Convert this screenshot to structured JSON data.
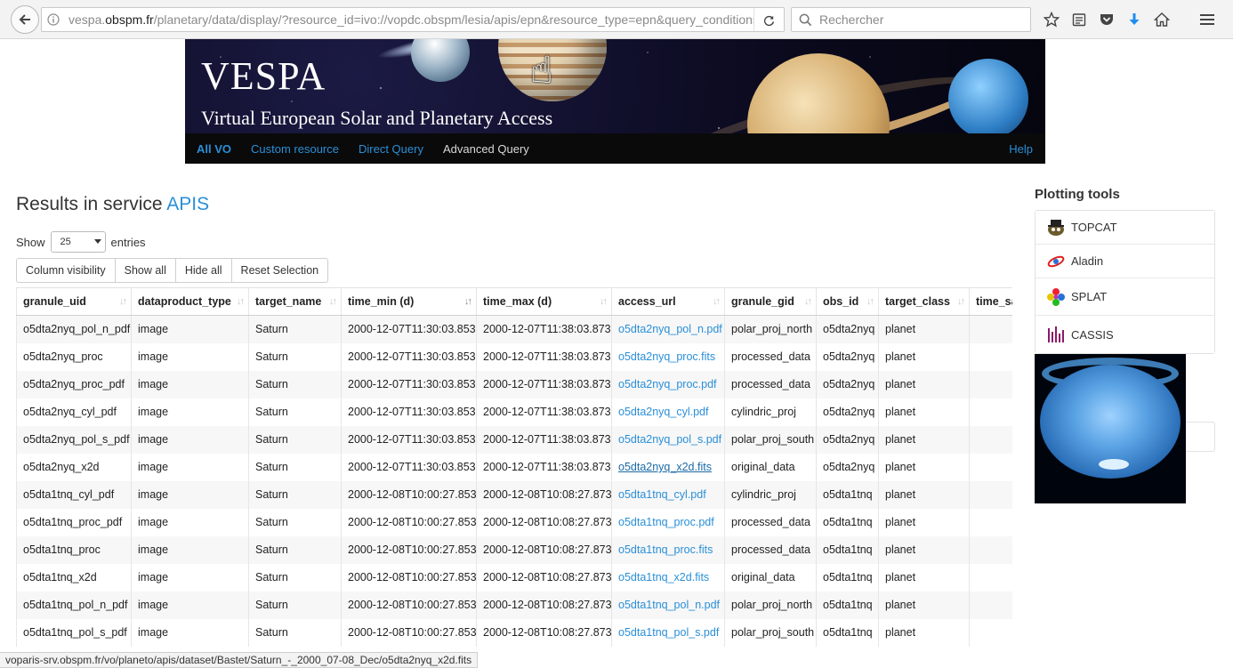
{
  "browser": {
    "url_prefix": "vespa.",
    "url_host": "obspm.fr",
    "url_path": "/planetary/data/display/?resource_id=ivo://vopdc.obspm/lesia/apis/epn&resource_type=epn&query_conditions",
    "search_placeholder": "Rechercher"
  },
  "banner": {
    "logo": "VESPA",
    "subtitle": "Virtual European Solar and Planetary Access",
    "nav": {
      "all_vo": "All VO",
      "custom_resource": "Custom resource",
      "direct_query": "Direct Query",
      "advanced_query": "Advanced Query",
      "help": "Help"
    }
  },
  "results": {
    "title_prefix": "Results in service",
    "service_name": "APIS",
    "show_label": "Show",
    "entries_value": "25",
    "entries_label": "entries",
    "buttons": {
      "column_visibility": "Column visibility",
      "show_all": "Show all",
      "hide_all": "Hide all",
      "reset_selection": "Reset Selection"
    },
    "columns": [
      "granule_uid",
      "dataproduct_type",
      "target_name",
      "time_min (d)",
      "time_max (d)",
      "access_url",
      "granule_gid",
      "obs_id",
      "target_class",
      "time_sa"
    ],
    "rows": [
      [
        "o5dta2nyq_pol_n_pdf",
        "image",
        "Saturn",
        "2000-12-07T11:30:03.853",
        "2000-12-07T11:38:03.873",
        "o5dta2nyq_pol_n.pdf",
        "polar_proj_north",
        "o5dta2nyq",
        "planet",
        ""
      ],
      [
        "o5dta2nyq_proc",
        "image",
        "Saturn",
        "2000-12-07T11:30:03.853",
        "2000-12-07T11:38:03.873",
        "o5dta2nyq_proc.fits",
        "processed_data",
        "o5dta2nyq",
        "planet",
        ""
      ],
      [
        "o5dta2nyq_proc_pdf",
        "image",
        "Saturn",
        "2000-12-07T11:30:03.853",
        "2000-12-07T11:38:03.873",
        "o5dta2nyq_proc.pdf",
        "processed_data",
        "o5dta2nyq",
        "planet",
        ""
      ],
      [
        "o5dta2nyq_cyl_pdf",
        "image",
        "Saturn",
        "2000-12-07T11:30:03.853",
        "2000-12-07T11:38:03.873",
        "o5dta2nyq_cyl.pdf",
        "cylindric_proj",
        "o5dta2nyq",
        "planet",
        ""
      ],
      [
        "o5dta2nyq_pol_s_pdf",
        "image",
        "Saturn",
        "2000-12-07T11:30:03.853",
        "2000-12-07T11:38:03.873",
        "o5dta2nyq_pol_s.pdf",
        "polar_proj_south",
        "o5dta2nyq",
        "planet",
        ""
      ],
      [
        "o5dta2nyq_x2d",
        "image",
        "Saturn",
        "2000-12-07T11:30:03.853",
        "2000-12-07T11:38:03.873",
        "o5dta2nyq_x2d.fits",
        "original_data",
        "o5dta2nyq",
        "planet",
        ""
      ],
      [
        "o5dta1tnq_cyl_pdf",
        "image",
        "Saturn",
        "2000-12-08T10:00:27.853",
        "2000-12-08T10:08:27.873",
        "o5dta1tnq_cyl.pdf",
        "cylindric_proj",
        "o5dta1tnq",
        "planet",
        ""
      ],
      [
        "o5dta1tnq_proc_pdf",
        "image",
        "Saturn",
        "2000-12-08T10:00:27.853",
        "2000-12-08T10:08:27.873",
        "o5dta1tnq_proc.pdf",
        "processed_data",
        "o5dta1tnq",
        "planet",
        ""
      ],
      [
        "o5dta1tnq_proc",
        "image",
        "Saturn",
        "2000-12-08T10:00:27.853",
        "2000-12-08T10:08:27.873",
        "o5dta1tnq_proc.fits",
        "processed_data",
        "o5dta1tnq",
        "planet",
        ""
      ],
      [
        "o5dta1tnq_x2d",
        "image",
        "Saturn",
        "2000-12-08T10:00:27.853",
        "2000-12-08T10:08:27.873",
        "o5dta1tnq_x2d.fits",
        "original_data",
        "o5dta1tnq",
        "planet",
        ""
      ],
      [
        "o5dta1tnq_pol_n_pdf",
        "image",
        "Saturn",
        "2000-12-08T10:00:27.853",
        "2000-12-08T10:08:27.873",
        "o5dta1tnq_pol_n.pdf",
        "polar_proj_north",
        "o5dta1tnq",
        "planet",
        ""
      ],
      [
        "o5dta1tnq_pol_s_pdf",
        "image",
        "Saturn",
        "2000-12-08T10:00:27.853",
        "2000-12-08T10:08:27.873",
        "o5dta1tnq_pol_s.pdf",
        "polar_proj_south",
        "o5dta1tnq",
        "planet",
        ""
      ]
    ]
  },
  "plotting": {
    "title": "Plotting tools",
    "tools": [
      "TOPCAT",
      "Aladin",
      "SPLAT",
      "CASSIS"
    ],
    "icons": [
      "topcat-icon",
      "aladin-icon",
      "splat-icon",
      "cassis-icon"
    ]
  },
  "statusbar": {
    "text": "voparis-srv.obspm.fr/vo/planeto/apis/dataset/Bastet/Saturn_-_2000_07-08_Dec/o5dta2nyq_x2d.fits"
  },
  "colors": {
    "link": "#2a8fd8",
    "nav_bg": "#0a0a0a",
    "row_stripe": "#f7f7f7"
  }
}
